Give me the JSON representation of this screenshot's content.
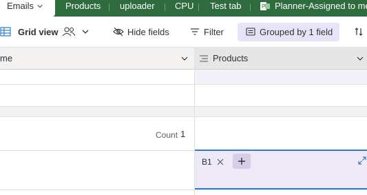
{
  "tabs": [
    {
      "label": "Emails",
      "active": true
    },
    {
      "label": "Products"
    },
    {
      "label": "uploader"
    },
    {
      "label": "CPU"
    },
    {
      "label": "Test tab"
    },
    {
      "label": "Planner-Assigned to me"
    }
  ],
  "toolbar": {
    "view_label": "Grid view",
    "hide_fields_label": "Hide fields",
    "filter_label": "Filter",
    "grouped_label": "Grouped by 1 field"
  },
  "grid": {
    "left_header_label": "me",
    "products_header_label": "Products",
    "count_label": "Count",
    "count_value": "1",
    "chip_label": "B1"
  },
  "colors": {
    "tab_bar": "#2e6b3d",
    "group_pill": "#e8e3f8",
    "selection_border": "#2b7cd3",
    "selected_cell": "#ede9f7"
  }
}
